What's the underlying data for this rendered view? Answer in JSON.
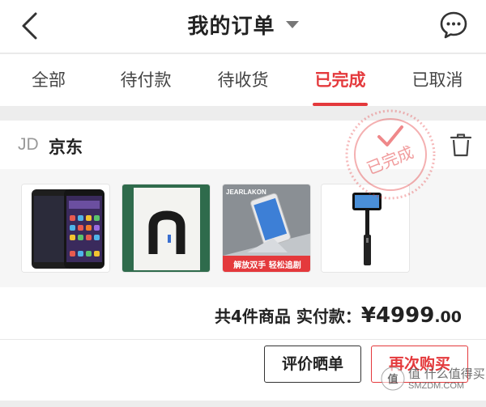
{
  "header": {
    "title": "我的订单"
  },
  "tabs": [
    {
      "label": "全部"
    },
    {
      "label": "待付款"
    },
    {
      "label": "待收货"
    },
    {
      "label": "已完成",
      "active": true
    },
    {
      "label": "已取消"
    }
  ],
  "order": {
    "shop_prefix": "JD",
    "shop_name": "京东",
    "stamp_text": "已完成",
    "products": [
      {
        "name": "phone"
      },
      {
        "name": "box"
      },
      {
        "name": "stand",
        "brand": "JEARLAKON",
        "caption": "解放双手 轻松追剧"
      },
      {
        "name": "selfie-stick"
      }
    ],
    "summary_label": "共4件商品  实付款：",
    "price_main": "¥4999",
    "price_cents": ".00",
    "buttons": {
      "review": "评价晒单",
      "rebuy": "再次购买"
    }
  },
  "watermark": {
    "text": "值 什么值得买",
    "sub": "SMZDM.COM"
  },
  "colors": {
    "accent": "#e4393c",
    "background": "#ededed"
  }
}
